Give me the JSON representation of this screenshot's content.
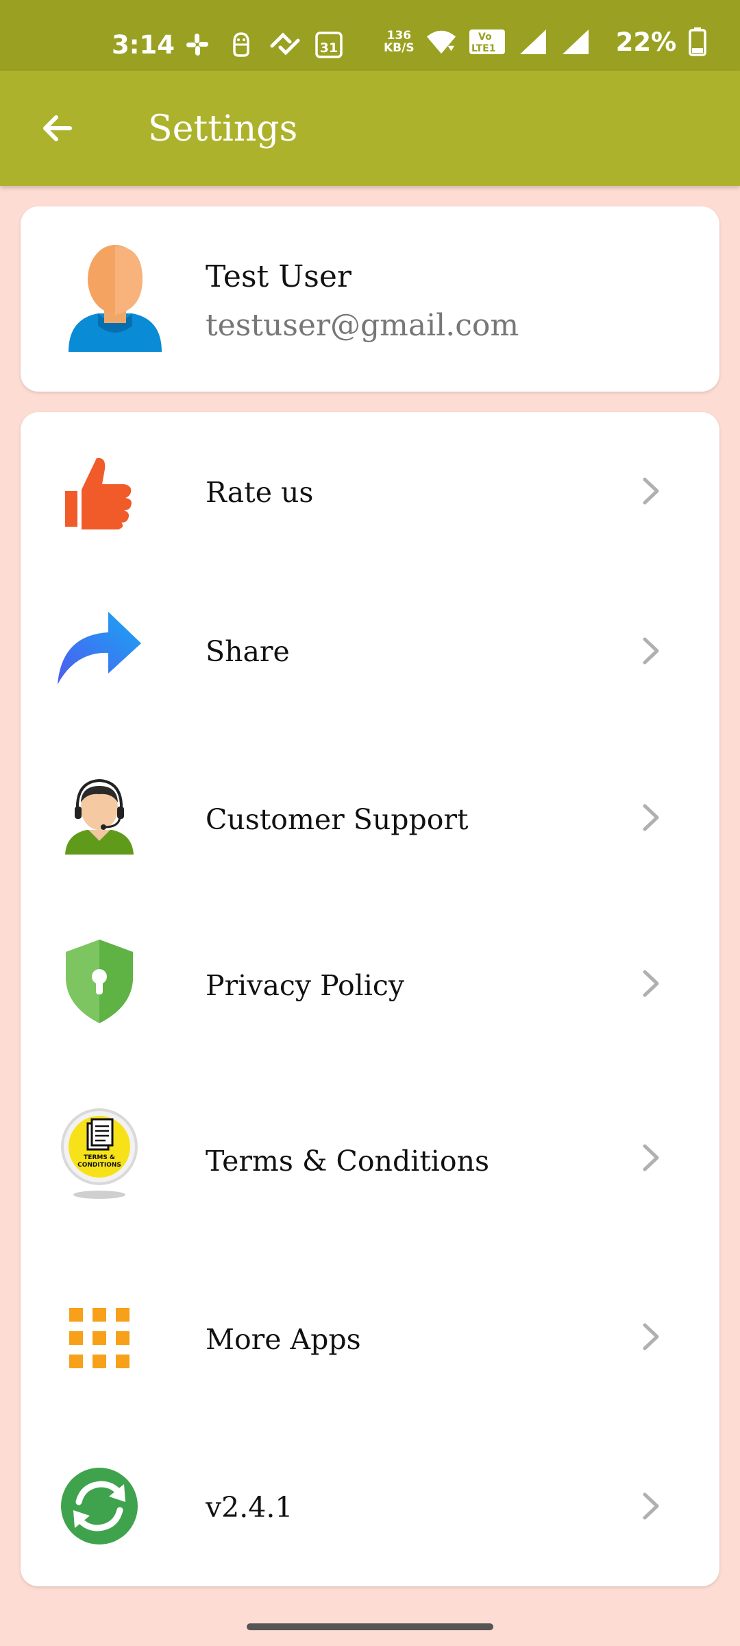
{
  "status_bar": {
    "time": "3:14",
    "calendar_day": "31",
    "net_speed_value": "136",
    "net_speed_unit": "KB/S",
    "volte_label_top": "Vo",
    "volte_label_bottom": "LTE1",
    "battery": "22%",
    "icons": [
      "slack-icon",
      "android-icon",
      "signal-sync-icon",
      "calendar-icon",
      "wifi-icon",
      "volte-icon",
      "signal-icon",
      "signal-icon",
      "battery-icon"
    ]
  },
  "app_bar": {
    "title": "Settings",
    "back_icon": "arrow-left-icon"
  },
  "profile": {
    "name": "Test User",
    "email": "testuser@gmail.com",
    "avatar_icon": "user-avatar-icon"
  },
  "menu": {
    "items": [
      {
        "label": "Rate us",
        "icon": "thumbs-up-icon"
      },
      {
        "label": "Share",
        "icon": "share-arrow-icon"
      },
      {
        "label": "Customer Support",
        "icon": "support-agent-icon"
      },
      {
        "label": "Privacy Policy",
        "icon": "shield-lock-icon"
      },
      {
        "label": "Terms & Conditions",
        "icon": "terms-conditions-icon",
        "badge_line1": "TERMS &",
        "badge_line2": "CONDITIONS"
      },
      {
        "label": "More Apps",
        "icon": "grid-apps-icon"
      },
      {
        "label": "v2.4.1",
        "icon": "update-sync-icon"
      }
    ]
  },
  "colors": {
    "status_bar": "#9aa122",
    "app_bar": "#adb22c",
    "background": "#fddcd3",
    "card": "#ffffff",
    "chevron": "#b0b0b0"
  }
}
